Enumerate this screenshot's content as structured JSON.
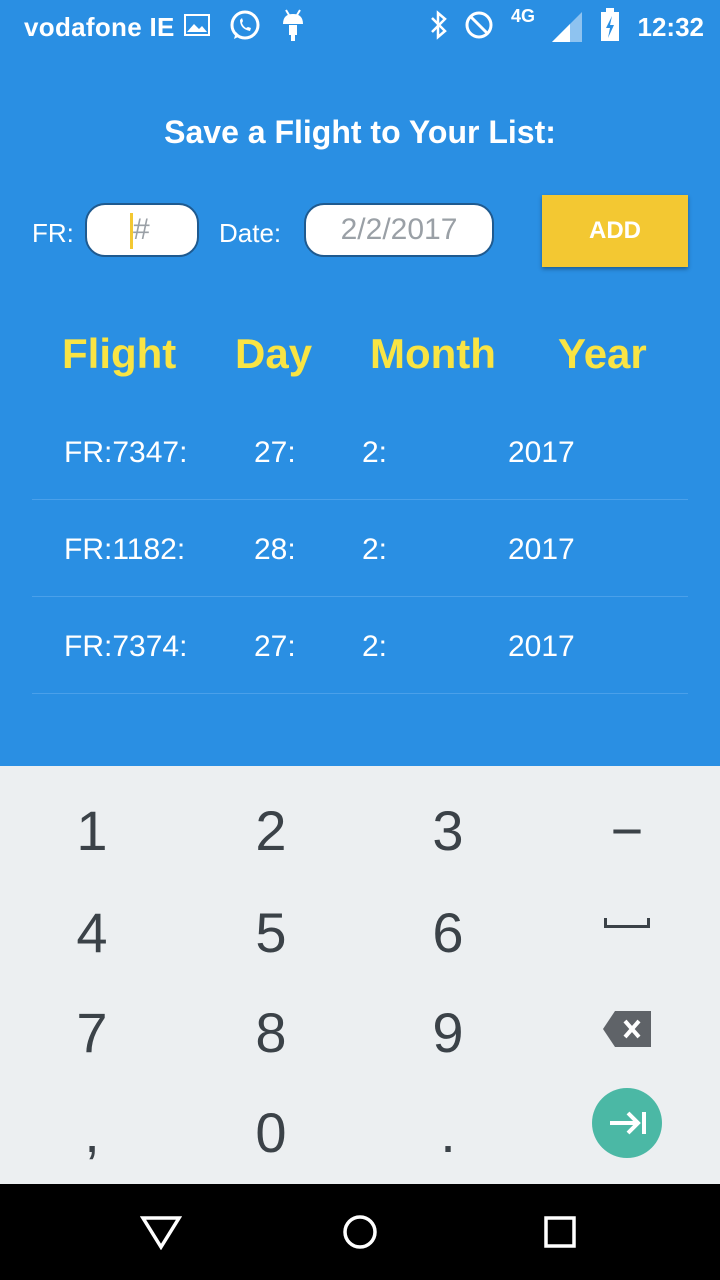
{
  "status_bar": {
    "carrier": "vodafone IE",
    "network": "4G",
    "time": "12:32",
    "icons": [
      "gallery-icon",
      "whatsapp-icon",
      "android-icon",
      "bluetooth-icon",
      "do-not-disturb-icon",
      "signal-icon",
      "battery-charging-icon"
    ]
  },
  "form": {
    "title": "Save a Flight to Your List:",
    "fr_label": "FR:",
    "fr_placeholder": "#",
    "date_label": "Date:",
    "date_value": "2/2/2017",
    "add_label": "ADD"
  },
  "table": {
    "headers": [
      "Flight",
      "Day",
      "Month",
      "Year"
    ],
    "rows": [
      {
        "flight": "FR:7347:",
        "day": "27:",
        "month": "2:",
        "year": "2017"
      },
      {
        "flight": "FR:1182:",
        "day": "28:",
        "month": "2:",
        "year": "2017"
      },
      {
        "flight": "FR:7374:",
        "day": "27:",
        "month": "2:",
        "year": "2017"
      }
    ]
  },
  "keyboard": {
    "keys": [
      "1",
      "2",
      "3",
      "−",
      "4",
      "5",
      "6",
      "␣",
      "7",
      "8",
      "9",
      "⌫",
      ",",
      "0",
      ".",
      "→|"
    ]
  },
  "colors": {
    "app_background": "#2a8fe3",
    "accent_yellow": "#f3c832",
    "header_yellow": "#f9e444",
    "enter_key": "#4bb8a5",
    "keyboard_bg": "#eceff1"
  }
}
